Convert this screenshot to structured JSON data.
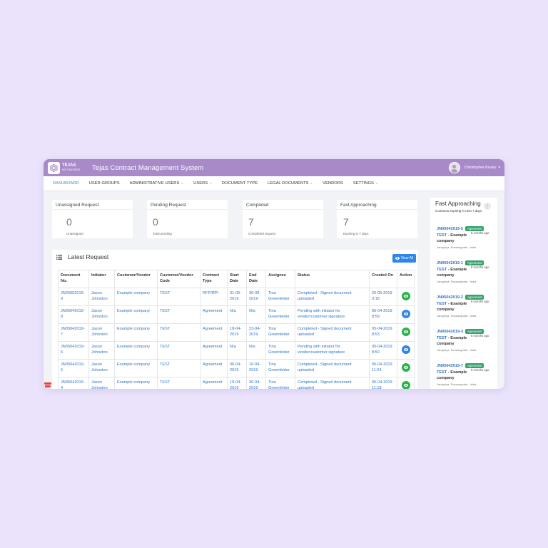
{
  "app": {
    "logo_name": "TEJAS",
    "logo_sub": "NETWORKS",
    "title": "Tejas Contract Management System",
    "user_name": "Christopher Kozey"
  },
  "colors": {
    "topbar": "#a98ac9",
    "accent": "#3d8bd8",
    "badge": "#33a36c",
    "view_green": "#2cb44a",
    "view_blue": "#2f86e6"
  },
  "nav": [
    {
      "label": "Dashboard",
      "active": true,
      "dropdown": false
    },
    {
      "label": "User Groups",
      "dropdown": false
    },
    {
      "label": "Administrative Users",
      "dropdown": true
    },
    {
      "label": "Users",
      "dropdown": true
    },
    {
      "label": "Document Type",
      "dropdown": false
    },
    {
      "label": "Legal Documents",
      "dropdown": true
    },
    {
      "label": "Vendors",
      "dropdown": false
    },
    {
      "label": "Settings",
      "dropdown": true
    }
  ],
  "stats": [
    {
      "title": "Unassigned Request",
      "value": "0",
      "sub": "Unassigned"
    },
    {
      "title": "Pending Request",
      "value": "0",
      "sub": "Total pending"
    },
    {
      "title": "Completed",
      "value": "7",
      "sub": "Completed request"
    },
    {
      "title": "Fast Approaching",
      "value": "7",
      "sub": "Expiring in 7 days"
    }
  ],
  "latest": {
    "title": "Latest Request",
    "view_all": "View All",
    "columns": [
      "Document No.",
      "Initiator",
      "Customer/Vendor",
      "Customer/Vendor Code",
      "Contract Type",
      "Start Date",
      "End Date",
      "Assignee",
      "Status",
      "Created On",
      "Action"
    ],
    "rows": [
      {
        "doc": "JN25052019-9",
        "initiator": "Jason Johnston",
        "customer": "Example company",
        "code": "TEST",
        "type": "RFP/RPI",
        "start": "31-05-2019",
        "end": "30-09-2019",
        "assignee": "Tina Greenfelder",
        "status": "Completed - Signed document uploaded",
        "created": "25-05-2019 3:18",
        "action": "green"
      },
      {
        "doc": "JN05042019-8",
        "initiator": "Jason Johnston",
        "customer": "Example company",
        "code": "TEST",
        "type": "Agreement",
        "start": "N/a",
        "end": "N/a",
        "assignee": "Tina Greenfelder",
        "status": "Pending with initiator for vendor/customer signature",
        "created": "05-04-2019 8:59",
        "action": "blue"
      },
      {
        "doc": "JN05042019-7",
        "initiator": "Jason Johnston",
        "customer": "Example company",
        "code": "TEST",
        "type": "Agreement",
        "start": "18-04-2019",
        "end": "23-04-2019",
        "assignee": "Tina Greenfelder",
        "status": "Completed - Signed document uploaded",
        "created": "05-04-2019 8:53",
        "action": "green"
      },
      {
        "doc": "JN05042019-6",
        "initiator": "Jason Johnston",
        "customer": "Example company",
        "code": "TEST",
        "type": "Agreement",
        "start": "N/a",
        "end": "N/a",
        "assignee": "Tina Greenfelder",
        "status": "Pending with initiator for vendor/customer signature",
        "created": "05-04-2019 8:50",
        "action": "blue"
      },
      {
        "doc": "JN05042019-5",
        "initiator": "Jason Johnston",
        "customer": "Example company",
        "code": "TEST",
        "type": "Agreement",
        "start": "06-04-2019",
        "end": "10-04-2019",
        "assignee": "Tina Greenfelder",
        "status": "Completed - Signed document uploaded",
        "created": "05-04-2019 11:24",
        "action": "green"
      },
      {
        "doc": "JN05042019-4",
        "initiator": "Jason Johnston",
        "customer": "Example company",
        "code": "TEST",
        "type": "Agreement",
        "start": "19-04-2019",
        "end": "30-04-2019",
        "assignee": "Tina Greenfelder",
        "status": "Completed - Signed document uploaded",
        "created": "05-04-2019 11:18",
        "action": "green"
      }
    ]
  },
  "fast": {
    "title": "Fast Approaching",
    "subtitle": "Contracts expiring in next 7 days",
    "items": [
      {
        "num": "JN05042019-5",
        "badge": "Agreement",
        "time": "8 months ago",
        "hl": "TEST",
        "rest": " - Example company",
        "loc": "Janapriya, Rossanghata - India"
      },
      {
        "num": "JN05042019-1",
        "badge": "Agreement",
        "time": "8 months ago",
        "hl": "TEST",
        "rest": " - Example company",
        "loc": "Janapriya, Rossanghata - India"
      },
      {
        "num": "JN05042019-2",
        "badge": "Agreement",
        "time": "8 months ago",
        "hl": "TEST",
        "rest": " - Example company",
        "loc": "Janapriya, Rossanghata - India"
      },
      {
        "num": "JN05042019-3",
        "badge": "Agreement",
        "time": "8 months ago",
        "hl": "TEST",
        "rest": " - Example company",
        "loc": "Janapriya, Rossanghata - India"
      },
      {
        "num": "JN05042019-7",
        "badge": "Agreement",
        "time": "8 months ago",
        "hl": "TEST",
        "rest": " - Example company",
        "loc": "Janapriya, Rossanghata - India"
      }
    ]
  }
}
